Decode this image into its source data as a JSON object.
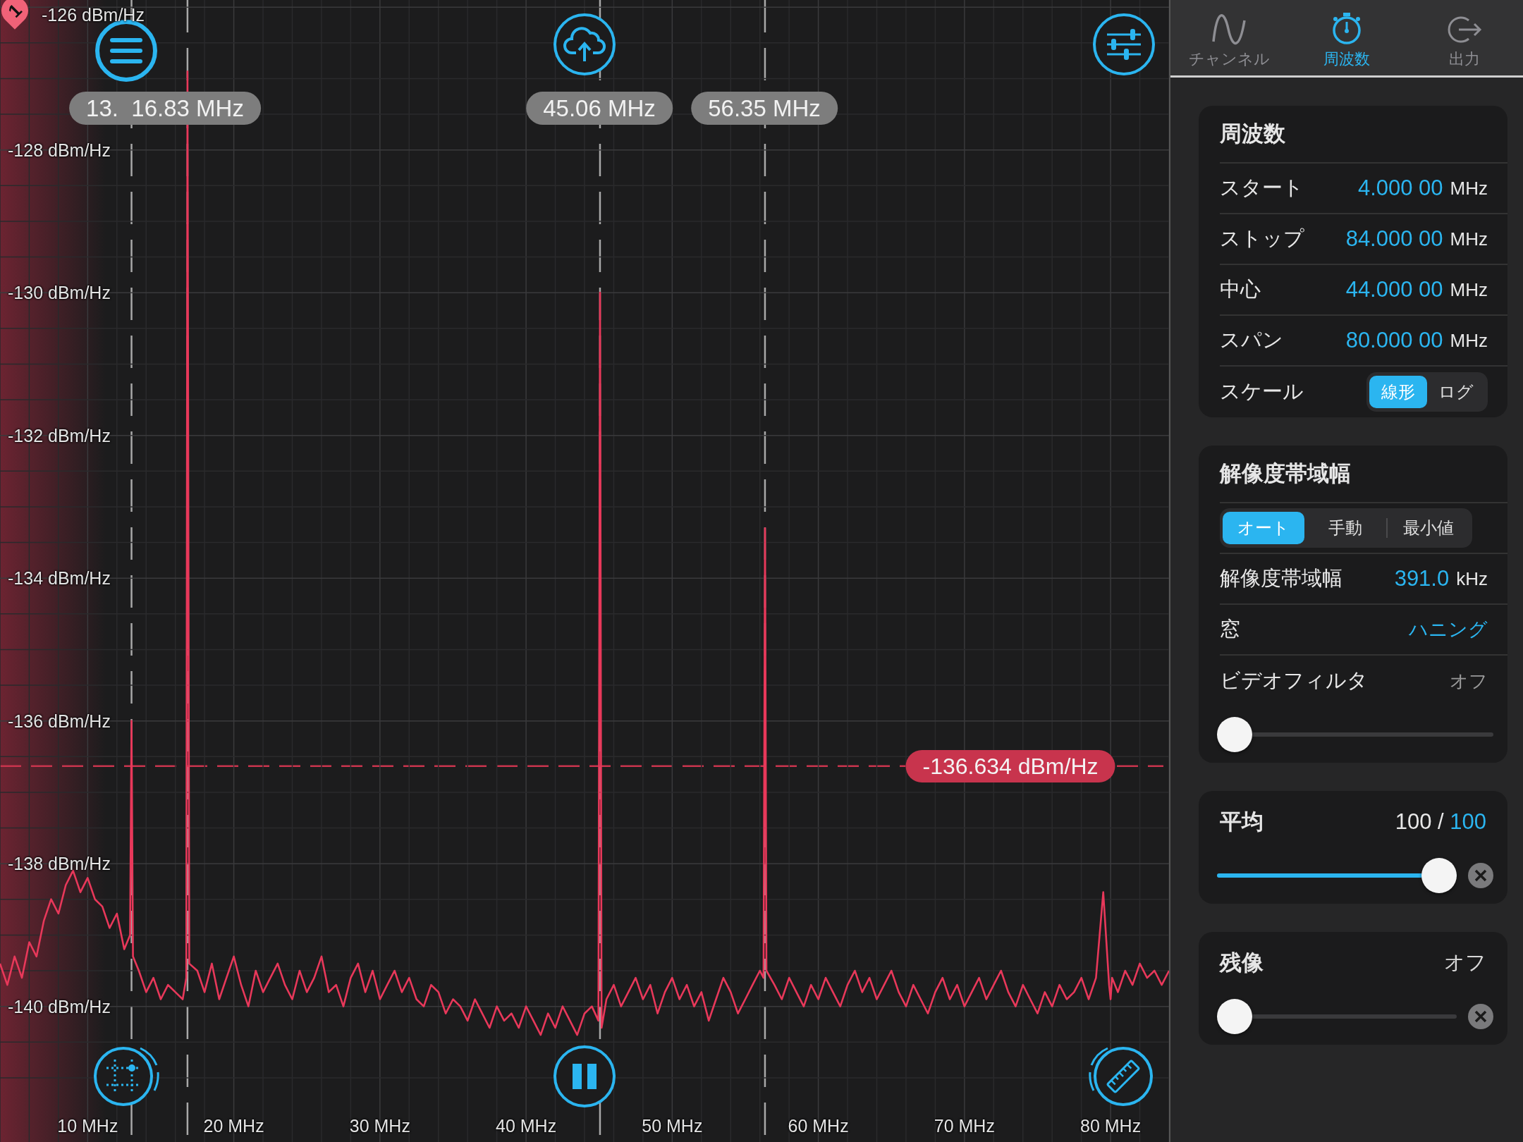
{
  "spectrum": {
    "marker_pin": "1",
    "markers": [
      {
        "label": "13.  16.83 MHz"
      },
      {
        "label": "45.06 MHz"
      },
      {
        "label": "56.35 MHz"
      }
    ],
    "top_level_label": "-126 dBm/Hz",
    "reference_level": "-136.634 dBm/Hz",
    "chart_data": {
      "type": "line",
      "xlim": [
        4,
        84
      ],
      "ylim": [
        -141.9,
        -125.9
      ],
      "grid": true,
      "xticks": [
        {
          "value": 10,
          "label": "10 MHz"
        },
        {
          "value": 20,
          "label": "20 MHz"
        },
        {
          "value": 30,
          "label": "30 MHz"
        },
        {
          "value": 40,
          "label": "40 MHz"
        },
        {
          "value": 50,
          "label": "50 MHz"
        },
        {
          "value": 60,
          "label": "60 MHz"
        },
        {
          "value": 70,
          "label": "70 MHz"
        },
        {
          "value": 80,
          "label": "80 MHz"
        }
      ],
      "yticks": [
        {
          "value": -128,
          "label": "-128 dBm/Hz"
        },
        {
          "value": -130,
          "label": "-130 dBm/Hz"
        },
        {
          "value": -132,
          "label": "-132 dBm/Hz"
        },
        {
          "value": -134,
          "label": "-134 dBm/Hz"
        },
        {
          "value": -136,
          "label": "-136 dBm/Hz"
        },
        {
          "value": -138,
          "label": "-138 dBm/Hz"
        },
        {
          "value": -140,
          "label": "-140 dBm/Hz"
        }
      ],
      "x": [
        4,
        4.5,
        5,
        5.5,
        6,
        6.5,
        7,
        7.5,
        8,
        8.5,
        9,
        9.5,
        10,
        10.5,
        11,
        11.5,
        12,
        12.5,
        12.9,
        13,
        13.1,
        13.5,
        14,
        14.5,
        15,
        15.5,
        16,
        16.5,
        16.75,
        16.83,
        16.95,
        17.5,
        18,
        18.5,
        19,
        19.5,
        20,
        20.5,
        21,
        21.5,
        22,
        22.5,
        23,
        23.5,
        24,
        24.5,
        25,
        25.5,
        26,
        26.5,
        27,
        27.5,
        28,
        28.5,
        29,
        29.5,
        30,
        30.5,
        31,
        31.5,
        32,
        32.5,
        33,
        33.5,
        34,
        34.5,
        35,
        35.5,
        36,
        36.5,
        37,
        37.5,
        38,
        38.5,
        39,
        39.5,
        40,
        40.5,
        41,
        41.5,
        42,
        42.5,
        43,
        43.5,
        44,
        44.5,
        44.95,
        45.06,
        45.17,
        45.5,
        46,
        46.5,
        47,
        47.5,
        48,
        48.5,
        49,
        49.5,
        50,
        50.5,
        51,
        51.5,
        52,
        52.5,
        53,
        53.5,
        54,
        54.5,
        55,
        55.5,
        56,
        56.25,
        56.35,
        56.45,
        57,
        57.5,
        58,
        58.5,
        59,
        59.5,
        60,
        60.5,
        61,
        61.5,
        62,
        62.5,
        63,
        63.5,
        64,
        64.5,
        65,
        65.5,
        66,
        66.5,
        67,
        67.5,
        68,
        68.5,
        69,
        69.5,
        70,
        70.5,
        71,
        71.5,
        72,
        72.5,
        73,
        73.5,
        74,
        74.5,
        75,
        75.5,
        76,
        76.5,
        77,
        77.5,
        78,
        78.5,
        79,
        79.5,
        79.9,
        80,
        80.1,
        80.5,
        81,
        81.5,
        82,
        82.5,
        83,
        83.5,
        84
      ],
      "series": [
        {
          "color": "#e8385a",
          "values": [
            -139.4,
            -139.7,
            -139.3,
            -139.6,
            -139.1,
            -139.3,
            -138.8,
            -138.5,
            -138.7,
            -138.3,
            -138.1,
            -138.4,
            -138.2,
            -138.5,
            -138.6,
            -138.9,
            -138.7,
            -139.2,
            -139.0,
            -136.0,
            -139.3,
            -139.5,
            -139.8,
            -139.6,
            -139.9,
            -139.7,
            -139.8,
            -139.9,
            -139.6,
            -126.9,
            -139.4,
            -139.5,
            -139.8,
            -139.4,
            -139.9,
            -139.6,
            -139.3,
            -139.7,
            -140.0,
            -139.5,
            -139.8,
            -139.6,
            -139.4,
            -139.7,
            -139.9,
            -139.5,
            -139.8,
            -139.6,
            -139.3,
            -139.8,
            -139.7,
            -140.0,
            -139.6,
            -139.4,
            -139.8,
            -139.5,
            -139.9,
            -139.7,
            -139.5,
            -139.8,
            -139.6,
            -139.9,
            -140.0,
            -139.7,
            -139.8,
            -140.1,
            -139.9,
            -140.0,
            -140.2,
            -139.9,
            -140.1,
            -140.3,
            -140.0,
            -140.2,
            -140.1,
            -140.3,
            -140.0,
            -140.2,
            -140.4,
            -140.1,
            -140.3,
            -140.0,
            -140.2,
            -140.4,
            -140.1,
            -140.0,
            -140.2,
            -130.0,
            -140.3,
            -139.9,
            -139.7,
            -140.0,
            -139.8,
            -139.6,
            -139.9,
            -139.7,
            -140.1,
            -139.8,
            -139.6,
            -139.9,
            -139.7,
            -140.0,
            -139.8,
            -140.2,
            -139.9,
            -139.6,
            -139.8,
            -140.1,
            -139.9,
            -139.7,
            -139.5,
            -139.6,
            -133.3,
            -139.5,
            -139.7,
            -139.9,
            -139.6,
            -139.8,
            -140.0,
            -139.7,
            -139.9,
            -139.6,
            -139.8,
            -140.0,
            -139.7,
            -139.5,
            -139.8,
            -139.6,
            -139.9,
            -139.7,
            -139.5,
            -139.8,
            -140.0,
            -139.7,
            -139.9,
            -140.1,
            -139.8,
            -139.6,
            -139.9,
            -139.7,
            -140.0,
            -139.8,
            -139.6,
            -139.9,
            -139.7,
            -139.5,
            -139.8,
            -140.0,
            -139.7,
            -139.9,
            -140.1,
            -139.8,
            -140.0,
            -139.7,
            -139.9,
            -139.8,
            -139.6,
            -139.9,
            -139.6,
            -138.4,
            -139.7,
            -139.9,
            -139.6,
            -139.8,
            -139.5,
            -139.7,
            -139.4,
            -139.6,
            -139.5,
            -139.7,
            -139.5
          ]
        }
      ]
    }
  },
  "tabs": [
    {
      "label": "チャンネル",
      "kind": "wave",
      "selected": false
    },
    {
      "label": "周波数",
      "kind": "stopwatch",
      "selected": true
    },
    {
      "label": "出力",
      "kind": "exit",
      "selected": false
    }
  ],
  "frequency": {
    "title": "周波数",
    "rows": [
      {
        "label": "スタート",
        "value": "4.000 00",
        "unit": "MHz"
      },
      {
        "label": "ストップ",
        "value": "84.000 00",
        "unit": "MHz"
      },
      {
        "label": "中心",
        "value": "44.000 00",
        "unit": "MHz"
      },
      {
        "label": "スパン",
        "value": "80.000 00",
        "unit": "MHz"
      }
    ],
    "scale": {
      "label": "スケール",
      "options": [
        {
          "label": "線形",
          "selected": true
        },
        {
          "label": "ログ",
          "selected": false
        }
      ]
    }
  },
  "bandwidth": {
    "title": "解像度帯域幅",
    "modes": [
      {
        "label": "オート",
        "selected": true
      },
      {
        "label": "手動",
        "selected": false
      },
      {
        "label": "最小値",
        "selected": false
      }
    ],
    "rbw": {
      "label": "解像度帯域幅",
      "value": "391.0",
      "unit": "kHz"
    },
    "window": {
      "label": "窓",
      "value": "ハニング"
    },
    "video_filter": {
      "label": "ビデオフィルタ",
      "value": "オフ",
      "level": 0
    }
  },
  "average": {
    "title": "平均",
    "count": "100",
    "separator": "/",
    "total": "100",
    "level": 1
  },
  "persistence": {
    "title": "残像",
    "value": "オフ",
    "level": 0
  }
}
